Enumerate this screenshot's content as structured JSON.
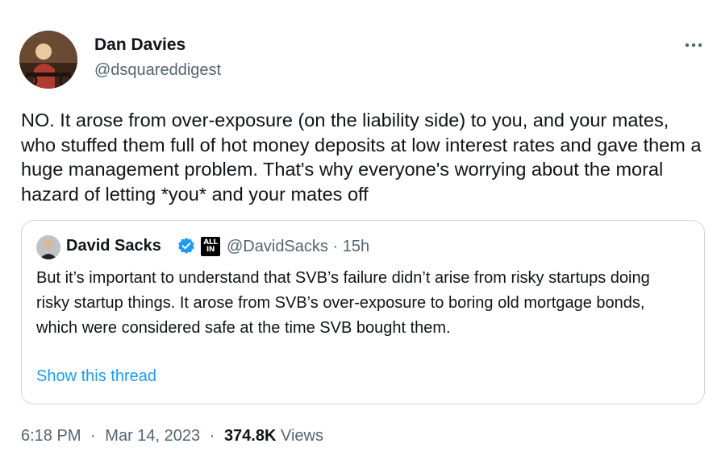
{
  "tweet": {
    "author": {
      "name": "Dan Davies",
      "handle": "@dsquareddigest"
    },
    "text": "NO. It arose from over-exposure (on the liability side) to you, and your mates, who stuffed them full of hot money deposits at low interest rates and gave them a huge management problem. That's why everyone's worrying about the moral hazard of letting *you* and your mates off",
    "more_icon": "more-horizontal-icon",
    "quote": {
      "author_name": "David Sacks",
      "verified_icon": "verified-badge-icon",
      "affiliate_badge": "ALL IN",
      "handle": "@DavidSacks",
      "separator": "·",
      "time": "15h",
      "text": "But it’s important to understand that SVB’s failure didn’t arise from risky startups doing risky startup things. It arose from SVB’s over-exposure to boring old mortgage bonds, which were considered safe at the time SVB bought them.",
      "show_thread": "Show this thread"
    },
    "footer": {
      "time": "6:18 PM",
      "separator": "·",
      "date": "Mar 14, 2023",
      "views_count": "374.8K",
      "views_label": "Views"
    }
  },
  "colors": {
    "text_primary": "#0f1419",
    "text_secondary": "#536471",
    "link": "#1d9bf0",
    "border": "#cfd9de",
    "verified": "#1d9bf0"
  }
}
